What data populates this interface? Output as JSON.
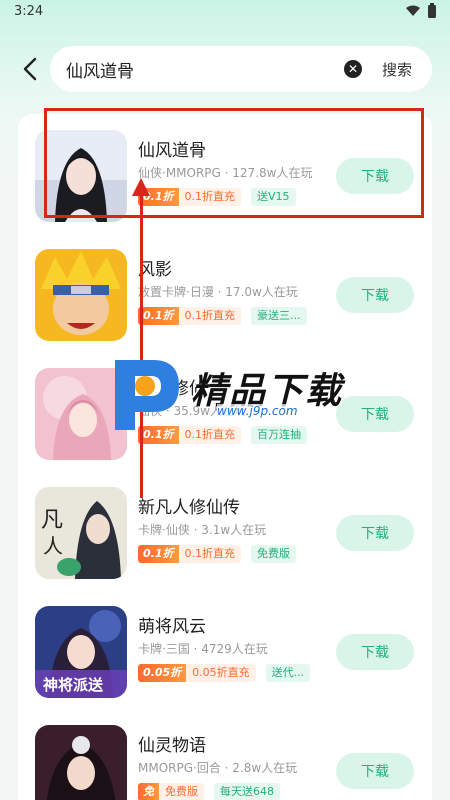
{
  "status_bar": {
    "time": "3:24"
  },
  "search": {
    "query": "仙风道骨",
    "button_label": "搜索",
    "clear_icon": "clear-icon",
    "back_icon": "back-arrow-icon"
  },
  "games": [
    {
      "title": "仙风道骨",
      "meta": "仙侠·MMORPG · 127.8w人在玩",
      "discount_label": "0.1折",
      "discount_text": "0.1折直充",
      "bonus": "送V15",
      "download_label": "下载"
    },
    {
      "title": "风影",
      "meta": "放置卡牌·日漫 · 17.0w人在玩",
      "discount_label": "0.1折",
      "discount_text": "0.1折直充",
      "bonus": "豪送三...",
      "download_label": "下载"
    },
    {
      "title": "逍遥修仙",
      "meta": "仙侠 · 35.9w人在玩",
      "discount_label": "0.1折",
      "discount_text": "0.1折直充",
      "bonus": "百万连抽",
      "download_label": "下载"
    },
    {
      "title": "新凡人修仙传",
      "meta": "卡牌·仙侠 · 3.1w人在玩",
      "discount_label": "0.1折",
      "discount_text": "0.1折直充",
      "bonus": "免费版",
      "download_label": "下载"
    },
    {
      "title": "萌将风云",
      "meta": "卡牌·三国 · 4729人在玩",
      "discount_label": "0.05折",
      "discount_text": "0.05折直充",
      "bonus": "送代...",
      "download_label": "下载"
    },
    {
      "title": "仙灵物语",
      "meta": "MMORPG·回合 · 2.8w人在玩",
      "discount_label": "免",
      "discount_text": "免费版",
      "bonus": "每天送648",
      "download_label": "下载"
    }
  ],
  "watermark": {
    "text": "精品下载",
    "url": "www.j9p.com"
  },
  "colors": {
    "accent_green": "#21b07a",
    "download_bg": "#d9f5e9",
    "discount_orange": "#ff6a2e",
    "highlight_red": "#d9261c"
  }
}
